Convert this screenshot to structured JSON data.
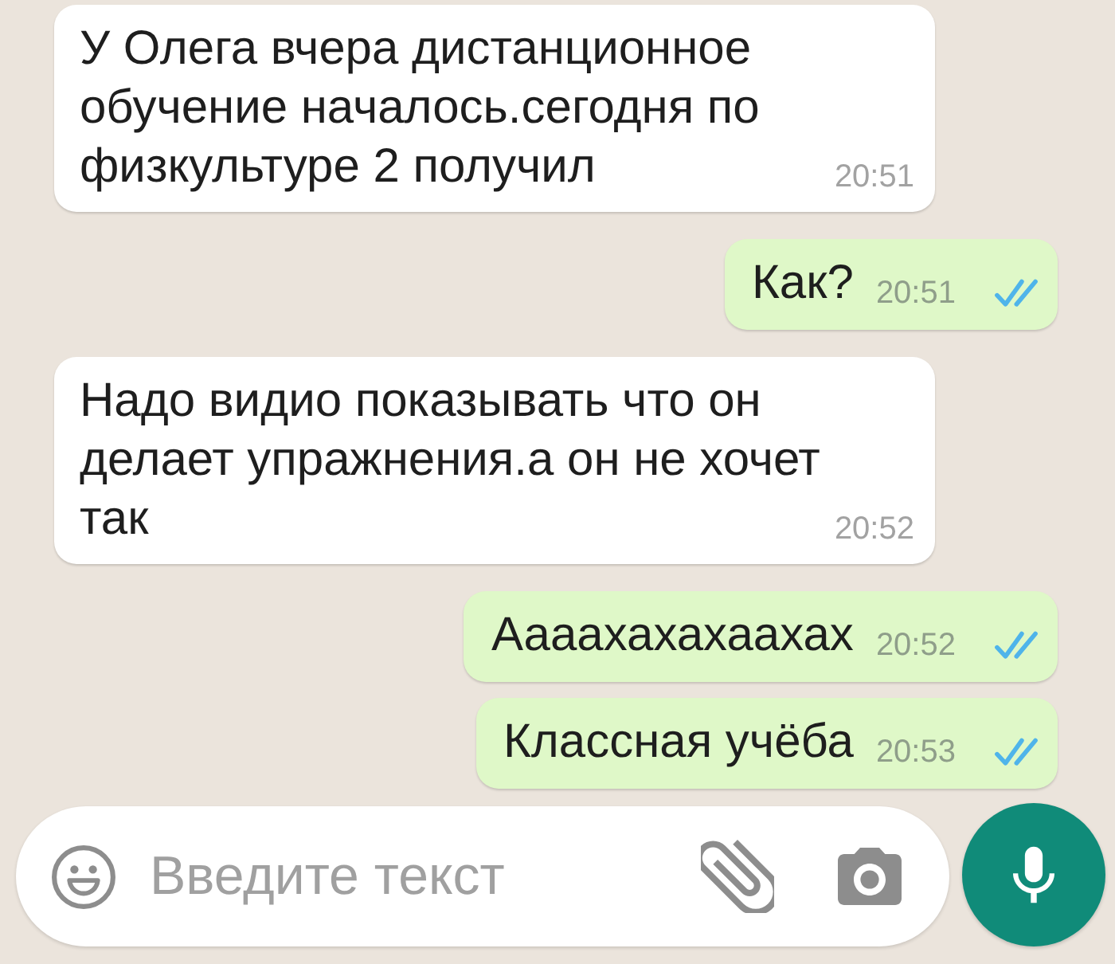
{
  "messages": [
    {
      "kind": "incoming",
      "text": "У Олега вчера дистанционное обучение началось.сегодня по физкультуре 2 получил",
      "time": "20:51"
    },
    {
      "kind": "outgoing",
      "text": "Как?",
      "time": "20:51",
      "read": true
    },
    {
      "kind": "incoming",
      "text": "Надо видио показывать что он делает упражнения.а он не хочет так",
      "time": "20:52"
    },
    {
      "kind": "outgoing",
      "text": "Аааахахахаахах",
      "time": "20:52",
      "read": true
    },
    {
      "kind": "outgoing",
      "text": "Классная учёба",
      "time": "20:53",
      "read": true
    }
  ],
  "composer": {
    "placeholder": "Введите текст"
  }
}
